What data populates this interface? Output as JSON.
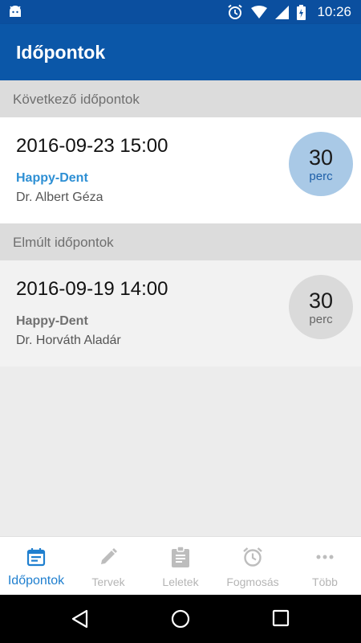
{
  "status_bar": {
    "time": "10:26"
  },
  "app_bar": {
    "title": "Időpontok"
  },
  "upcoming": {
    "header": "Következő időpontok",
    "items": [
      {
        "datetime": "2016-09-23 15:00",
        "clinic": "Happy-Dent",
        "doctor": "Dr. Albert Géza",
        "duration_value": "30",
        "duration_unit": "perc"
      }
    ]
  },
  "past": {
    "header": "Elmúlt időpontok",
    "items": [
      {
        "datetime": "2016-09-19 14:00",
        "clinic": "Happy-Dent",
        "doctor": "Dr. Horváth Aladár",
        "duration_value": "30",
        "duration_unit": "perc"
      }
    ]
  },
  "bottom_nav": {
    "items": [
      {
        "label": "Időpontok",
        "icon": "calendar-icon",
        "active": true
      },
      {
        "label": "Tervek",
        "icon": "pencil-icon",
        "active": false
      },
      {
        "label": "Leletek",
        "icon": "clipboard-icon",
        "active": false
      },
      {
        "label": "Fogmosás",
        "icon": "alarm-clock-icon",
        "active": false
      },
      {
        "label": "Több",
        "icon": "more-dots-icon",
        "active": false
      }
    ]
  },
  "colors": {
    "primary": "#0b57a8",
    "status_bar": "#0b4f9f",
    "accent": "#1f7fcf",
    "upcoming_badge": "#a9c9e6",
    "past_badge": "#dadada"
  }
}
